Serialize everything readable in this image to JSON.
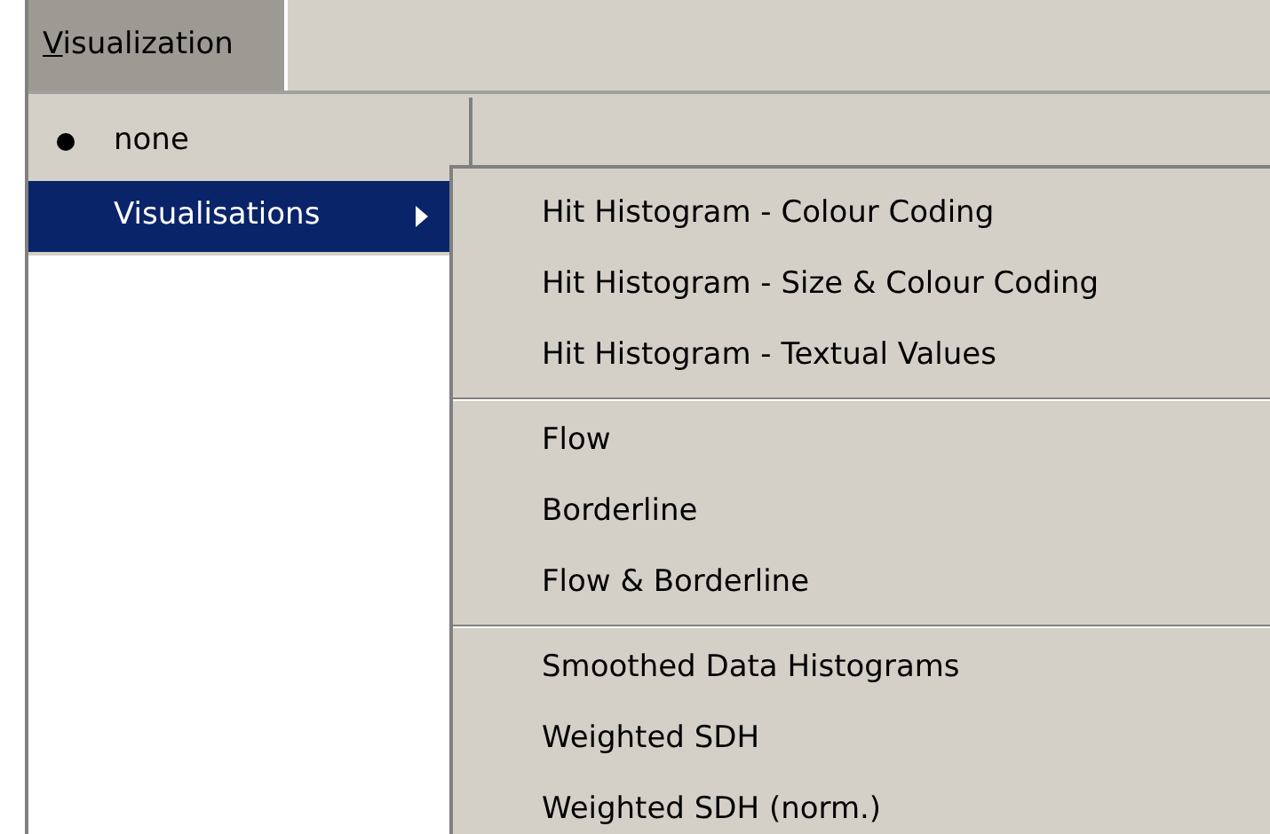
{
  "menu_bar": [
    {
      "label": "Visualization",
      "first_letter_underlined": true,
      "selected": true
    }
  ],
  "dropdown": [
    {
      "label": "none",
      "kind": "radio",
      "checked": true,
      "selected": false
    },
    {
      "label": "Visualisations",
      "kind": "submenu",
      "checked": false,
      "selected": true
    }
  ],
  "submenu": [
    [
      {
        "label": "Hit Histogram - Colour Coding"
      },
      {
        "label": "Hit Histogram - Size & Colour Coding"
      },
      {
        "label": "Hit Histogram - Textual Values"
      }
    ],
    [
      {
        "label": "Flow"
      },
      {
        "label": "Borderline"
      },
      {
        "label": "Flow & Borderline"
      }
    ],
    [
      {
        "label": "Smoothed Data Histograms"
      },
      {
        "label": "Weighted SDH"
      },
      {
        "label": "Weighted SDH (norm.)"
      }
    ]
  ]
}
